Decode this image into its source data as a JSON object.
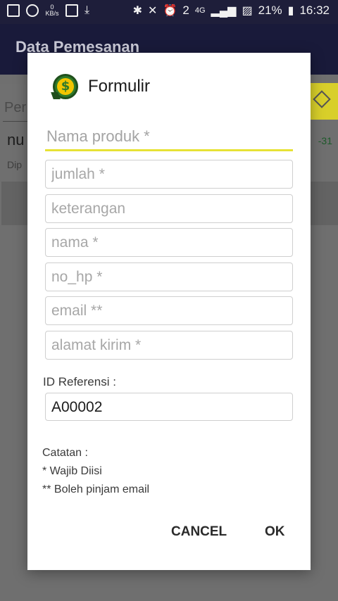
{
  "status_bar": {
    "kbs_value": "0",
    "kbs_unit": "KB/s",
    "sim_badge": "2",
    "network": "4G",
    "battery": "21%",
    "time": "16:32"
  },
  "app": {
    "title": "Data Pemesanan",
    "search_text": "Per",
    "item_title": "nu",
    "item_sub": "Dip",
    "item_date": "-31"
  },
  "dialog": {
    "title": "Formulir",
    "icon": "money-bag-icon",
    "fields": [
      {
        "name": "nama-produk",
        "placeholder": "Nama produk *",
        "value": ""
      },
      {
        "name": "jumlah",
        "placeholder": "jumlah *",
        "value": ""
      },
      {
        "name": "keterangan",
        "placeholder": "keterangan",
        "value": ""
      },
      {
        "name": "nama",
        "placeholder": "nama *",
        "value": ""
      },
      {
        "name": "no-hp",
        "placeholder": "no_hp *",
        "value": ""
      },
      {
        "name": "email",
        "placeholder": "email **",
        "value": ""
      },
      {
        "name": "alamat-kirim",
        "placeholder": "alamat kirim *",
        "value": ""
      }
    ],
    "id_ref_label": "ID Referensi :",
    "id_ref_value": "A00002",
    "notes": {
      "heading": "Catatan :",
      "line1": "* Wajib Diisi",
      "line2": "** Boleh pinjam email"
    },
    "cancel_label": "CANCEL",
    "ok_label": "OK"
  },
  "colors": {
    "accent_underline": "#e7e235",
    "appbar": "#191a3a",
    "status_bar": "#1e1e3a",
    "icon_green": "#2f7a2a",
    "icon_gold": "#f2c500"
  }
}
